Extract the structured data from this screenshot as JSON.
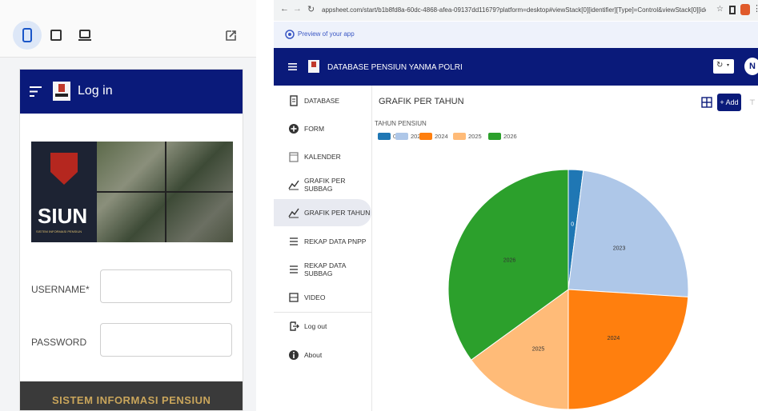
{
  "device_bar": {
    "buttons": [
      {
        "icon": "phone-icon",
        "active": true
      },
      {
        "icon": "tablet-icon",
        "active": false
      },
      {
        "icon": "desktop-icon",
        "active": false
      }
    ],
    "edit_icon": "edit-external-icon"
  },
  "login": {
    "title": "Log in",
    "menu_icon": "menu-icon",
    "hero_brand": "SIUN",
    "hero_subtitle": "SISTEM INFORMASI PENSIUN",
    "username_label": "USERNAME*",
    "password_label": "PASSWORD",
    "footer_text": "SISTEM INFORMASI PENSIUN"
  },
  "browser": {
    "url": "appsheet.com/start/b1b8fd8a-60dc-4868-afea-09137dd11679?platform=desktop#viewStack[0][identifier][Type]=Control&viewStack[0][identifier][Name]=..."
  },
  "preview": {
    "text": "Preview of your app"
  },
  "app": {
    "title": "DATABASE PENSIUN YANMA POLRI",
    "avatar_letter": "N",
    "add_label": "+ Add"
  },
  "sidebar": {
    "items": [
      {
        "label": "DATABASE",
        "icon": "database-icon",
        "active": false
      },
      {
        "label": "FORM",
        "icon": "plus-circle-icon",
        "active": false
      },
      {
        "label": "KALENDER",
        "icon": "calendar-icon",
        "active": false
      },
      {
        "label": "GRAFIK PER SUBBAG",
        "icon": "chart-icon",
        "active": false
      },
      {
        "label": "GRAFIK PER TAHUN",
        "icon": "chart-icon",
        "active": true
      },
      {
        "label": "REKAP DATA PNPP",
        "icon": "list-icon",
        "active": false
      },
      {
        "label": "REKAP DATA SUBBAG",
        "icon": "list-icon",
        "active": false
      },
      {
        "label": "VIDEO",
        "icon": "video-icon",
        "active": false
      },
      {
        "label": "Log out",
        "icon": "logout-icon",
        "active": false
      },
      {
        "label": "About",
        "icon": "info-icon",
        "active": false
      }
    ]
  },
  "view": {
    "title": "GRAFIK PER TAHUN"
  },
  "chart_data": {
    "type": "pie",
    "legend_title": "TAHUN PENSIUN",
    "legend_placement": "top-left",
    "categories": [
      "0",
      "2023",
      "2024",
      "2025",
      "2026"
    ],
    "values": [
      2,
      24,
      24,
      15,
      35
    ],
    "colors": [
      "#1f77b4",
      "#aec7e8",
      "#ff7f0e",
      "#ffbb78",
      "#2ca02c"
    ]
  }
}
